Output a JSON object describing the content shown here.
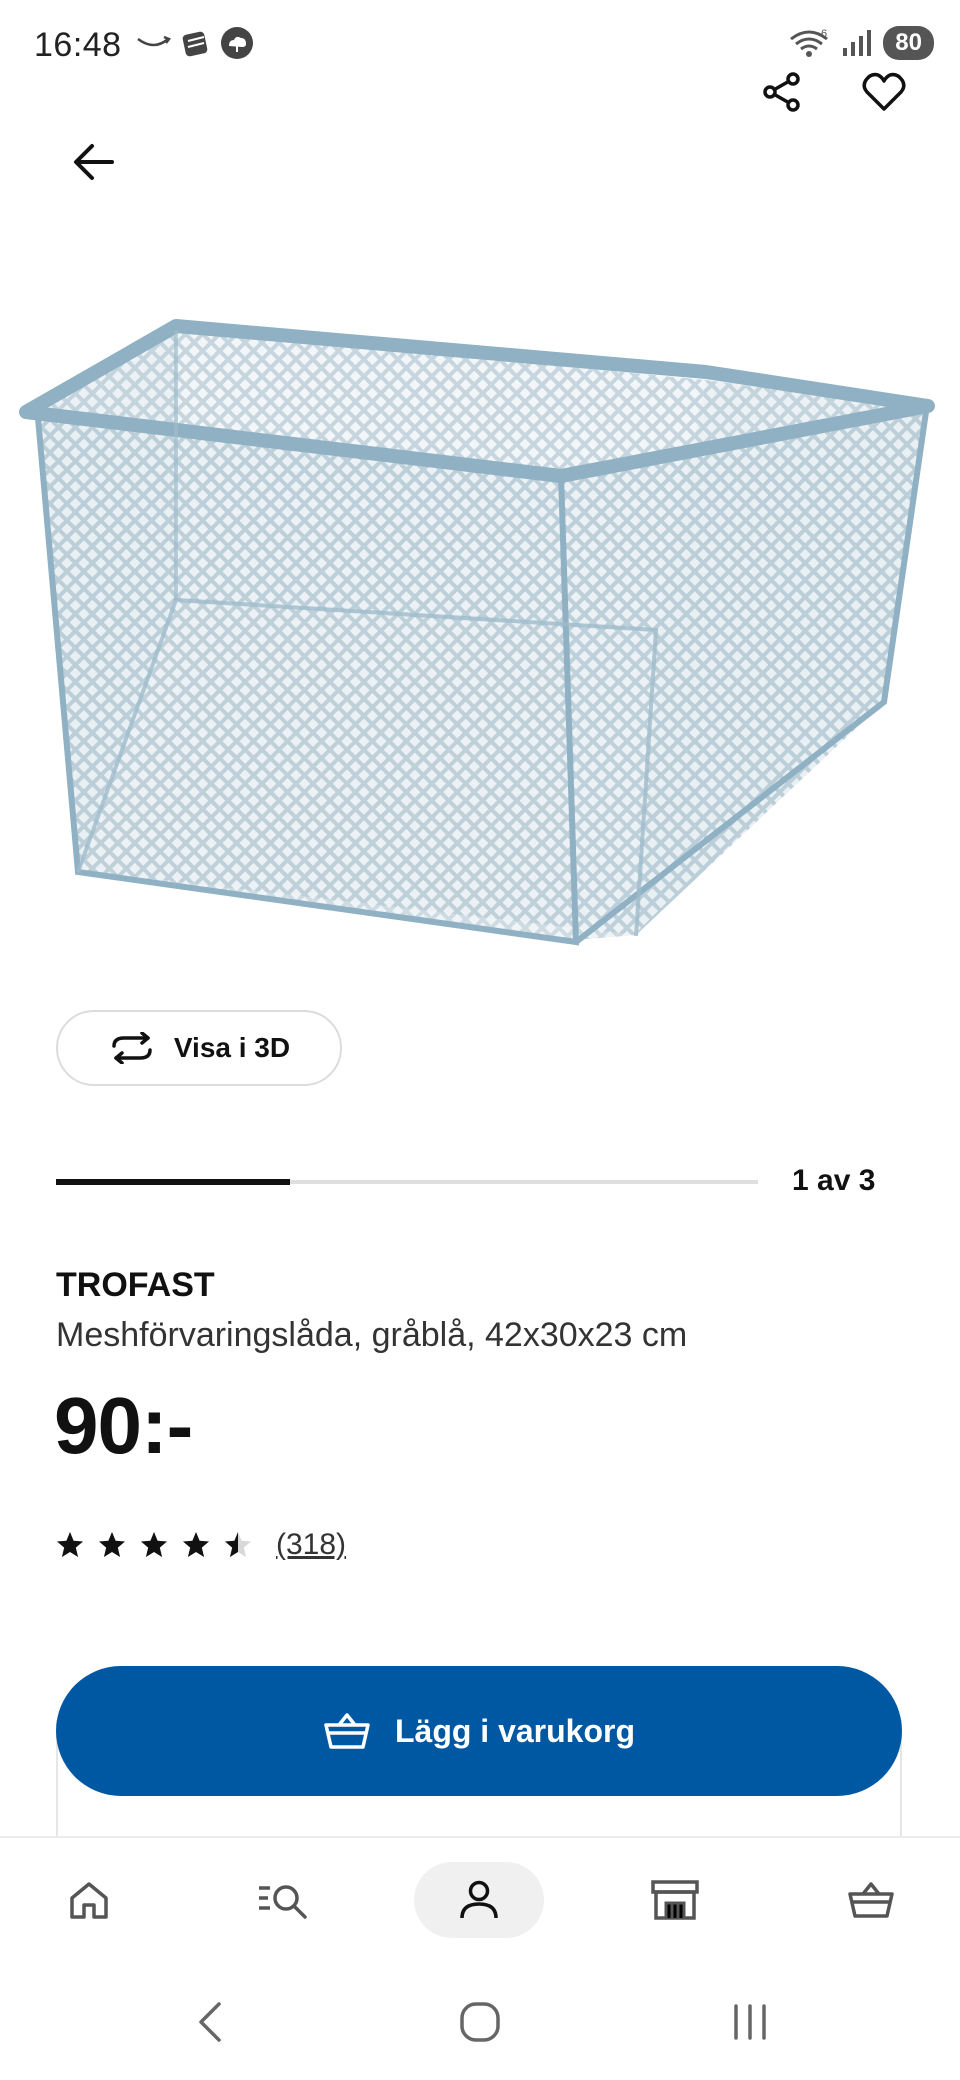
{
  "status_bar": {
    "time": "16:48",
    "battery": "80",
    "icons_left": [
      "amazon-smile-icon",
      "stack-icon",
      "cloud-icon"
    ],
    "icons_right": [
      "wifi-icon",
      "signal-icon",
      "battery-icon"
    ]
  },
  "header": {
    "back_icon": "arrow-left-icon",
    "share_icon": "share-icon",
    "favorite_icon": "heart-icon"
  },
  "gallery": {
    "view_3d_label": "Visa i 3D",
    "position_label": "1 av 3",
    "current_index": 1,
    "total": 3
  },
  "product": {
    "brand": "TROFAST",
    "description": "Meshförvaringslåda, gråblå, 42x30x23 cm",
    "price": "90:-",
    "rating": 4.5,
    "rating_max": 5,
    "reviews": "(318)",
    "color": "#8fb1c3"
  },
  "actions": {
    "add_to_cart_label": "Lägg i varukorg",
    "accent": "#0058a3"
  },
  "bottom_nav": {
    "items": [
      {
        "name": "home",
        "icon": "home-icon"
      },
      {
        "name": "search",
        "icon": "search-list-icon"
      },
      {
        "name": "profile",
        "icon": "person-icon",
        "active": true
      },
      {
        "name": "store",
        "icon": "store-icon"
      },
      {
        "name": "cart",
        "icon": "basket-icon"
      }
    ]
  },
  "system_nav": {
    "items": [
      "back-icon",
      "home-circle-icon",
      "recents-icon"
    ]
  }
}
